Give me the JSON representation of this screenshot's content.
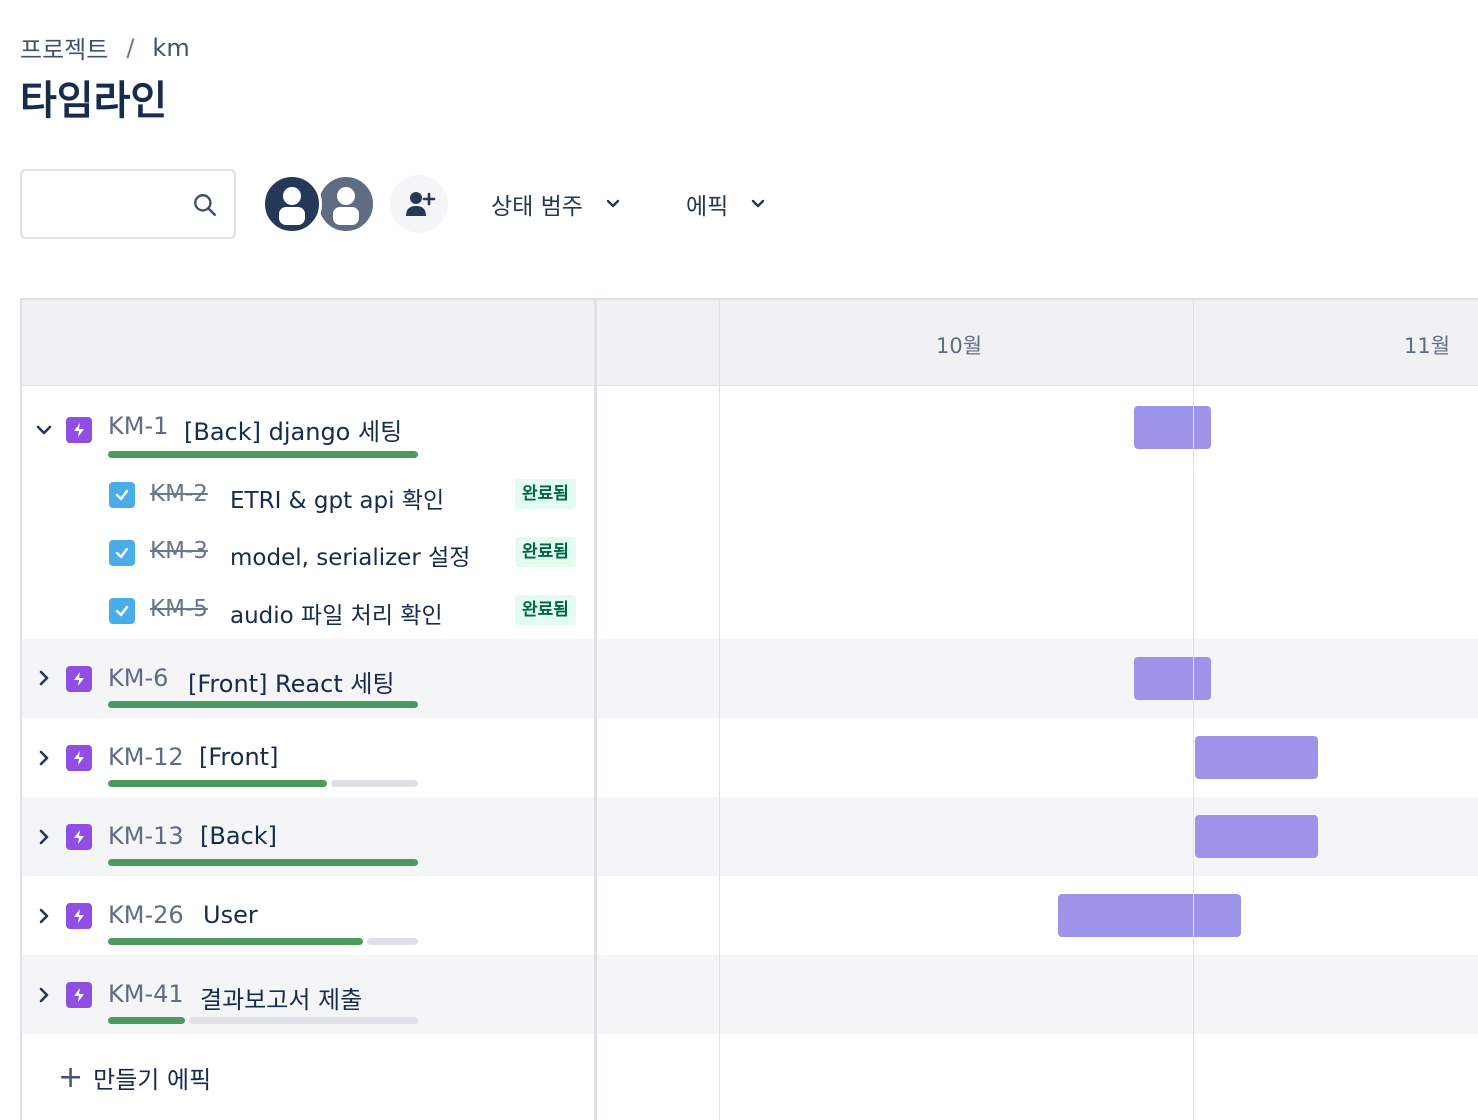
{
  "breadcrumb": {
    "parent": "프로젝트",
    "separator": "/",
    "current": "km"
  },
  "page_title": "타임라인",
  "search": {
    "placeholder": "",
    "value": ""
  },
  "filters": {
    "status_category": "상태 범주",
    "epic": "에픽"
  },
  "months": [
    "10월",
    "11월"
  ],
  "epics": [
    {
      "key": "KM-1",
      "title": "[Back] django 세팅",
      "expanded": true,
      "progress_done": 1.0,
      "bar_color": "#9D94EA",
      "children": [
        {
          "key": "KM-2",
          "title": "ETRI & gpt api 확인",
          "status": "완료됨"
        },
        {
          "key": "KM-3",
          "title": "model, serializer 설정",
          "status": "완료됨"
        },
        {
          "key": "KM-5",
          "title": "audio 파일 처리 확인",
          "status": "완료됨"
        }
      ]
    },
    {
      "key": "KM-6",
      "title": "[Front] React 세팅",
      "expanded": false,
      "progress_done": 1.0
    },
    {
      "key": "KM-12",
      "title": "[Front]",
      "expanded": false,
      "progress_done": 0.71
    },
    {
      "key": "KM-13",
      "title": "[Back]",
      "expanded": false,
      "progress_done": 1.0
    },
    {
      "key": "KM-26",
      "title": "User",
      "expanded": false,
      "progress_done": 0.83
    },
    {
      "key": "KM-41",
      "title": "결과보고서 제출",
      "expanded": false,
      "progress_done": 0.25
    }
  ],
  "create_epic_label": "만들기 에픽",
  "colors": {
    "epic_icon": "#904EE2",
    "bar": "#9D94EA",
    "progress_done": "#4C9A5F",
    "progress_todo": "#DFE1E6",
    "done_badge_bg": "#E3FCEF",
    "done_badge_text": "#006644"
  }
}
